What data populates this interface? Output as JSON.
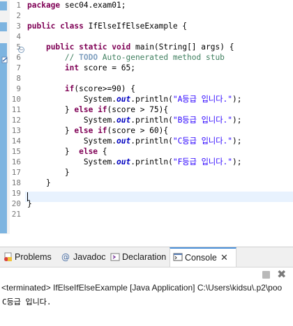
{
  "editor": {
    "lines": [
      {
        "n": "1",
        "tokens": [
          {
            "t": "package",
            "c": "kw"
          },
          {
            "t": " sec04.exam01;"
          }
        ]
      },
      {
        "n": "2",
        "tokens": []
      },
      {
        "n": "3",
        "tokens": [
          {
            "t": "public",
            "c": "kw"
          },
          {
            "t": " "
          },
          {
            "t": "class",
            "c": "kw"
          },
          {
            "t": " IfElseIfElseExample {"
          }
        ]
      },
      {
        "n": "4",
        "tokens": []
      },
      {
        "n": "5",
        "tokens": [
          {
            "t": "    "
          },
          {
            "t": "public",
            "c": "kw"
          },
          {
            "t": " "
          },
          {
            "t": "static",
            "c": "kw"
          },
          {
            "t": " "
          },
          {
            "t": "void",
            "c": "kw"
          },
          {
            "t": " main(String[] args) {"
          }
        ]
      },
      {
        "n": "6",
        "tokens": [
          {
            "t": "        "
          },
          {
            "t": "// ",
            "c": "cm"
          },
          {
            "t": "TODO",
            "c": "cm-todo"
          },
          {
            "t": " Auto-generated method stub",
            "c": "cm"
          }
        ]
      },
      {
        "n": "7",
        "tokens": [
          {
            "t": "        "
          },
          {
            "t": "int",
            "c": "kw"
          },
          {
            "t": " score = 65;"
          }
        ]
      },
      {
        "n": "8",
        "tokens": []
      },
      {
        "n": "9",
        "tokens": [
          {
            "t": "        "
          },
          {
            "t": "if",
            "c": "kw"
          },
          {
            "t": "(score>=90) {"
          }
        ]
      },
      {
        "n": "10",
        "tokens": [
          {
            "t": "            System."
          },
          {
            "t": "out",
            "c": "fld"
          },
          {
            "t": ".println("
          },
          {
            "t": "\"A등급 입니다.\"",
            "c": "str"
          },
          {
            "t": ");"
          }
        ]
      },
      {
        "n": "11",
        "tokens": [
          {
            "t": "        } "
          },
          {
            "t": "else",
            "c": "kw"
          },
          {
            "t": " "
          },
          {
            "t": "if",
            "c": "kw"
          },
          {
            "t": "(score > 75){"
          }
        ]
      },
      {
        "n": "12",
        "tokens": [
          {
            "t": "            System."
          },
          {
            "t": "out",
            "c": "fld"
          },
          {
            "t": ".println("
          },
          {
            "t": "\"B등급 입니다.\"",
            "c": "str"
          },
          {
            "t": ");"
          }
        ]
      },
      {
        "n": "13",
        "tokens": [
          {
            "t": "        } "
          },
          {
            "t": "else",
            "c": "kw"
          },
          {
            "t": " "
          },
          {
            "t": "if",
            "c": "kw"
          },
          {
            "t": "(score > 60){"
          }
        ]
      },
      {
        "n": "14",
        "tokens": [
          {
            "t": "            System."
          },
          {
            "t": "out",
            "c": "fld"
          },
          {
            "t": ".println("
          },
          {
            "t": "\"C등급 입니다.\"",
            "c": "str"
          },
          {
            "t": ");"
          }
        ]
      },
      {
        "n": "15",
        "tokens": [
          {
            "t": "        }  "
          },
          {
            "t": "else",
            "c": "kw"
          },
          {
            "t": " {"
          }
        ]
      },
      {
        "n": "16",
        "tokens": [
          {
            "t": "            System."
          },
          {
            "t": "out",
            "c": "fld"
          },
          {
            "t": ".println("
          },
          {
            "t": "\"F등급 입니다.\"",
            "c": "str"
          },
          {
            "t": ");"
          }
        ]
      },
      {
        "n": "17",
        "tokens": [
          {
            "t": "        }"
          }
        ]
      },
      {
        "n": "18",
        "tokens": [
          {
            "t": "    }"
          }
        ]
      },
      {
        "n": "19",
        "tokens": []
      },
      {
        "n": "20",
        "tokens": [
          {
            "t": "}"
          }
        ]
      },
      {
        "n": "21",
        "tokens": []
      }
    ],
    "collapse_glyph": "−",
    "scroll_left_glyph": "<"
  },
  "views": {
    "tabs": [
      {
        "label": "Problems",
        "icon": "problems-icon"
      },
      {
        "label": "Javadoc",
        "icon": "javadoc-icon"
      },
      {
        "label": "Declaration",
        "icon": "declaration-icon"
      },
      {
        "label": "Console",
        "icon": "console-icon",
        "active": true
      }
    ],
    "close_glyph": "✕",
    "remove_glyph": "✖",
    "status": "<terminated> IfElseIfElseExample [Java Application] C:\\Users\\kidsu\\.p2\\poo",
    "output": "C등급 입니다."
  },
  "colors": {
    "keyword": "#7f0055",
    "comment": "#3f7f5f",
    "string": "#2a00ff",
    "field": "#0000c0",
    "current_line": "#e8f2fe",
    "ruler_mark": "#7db4e0"
  }
}
